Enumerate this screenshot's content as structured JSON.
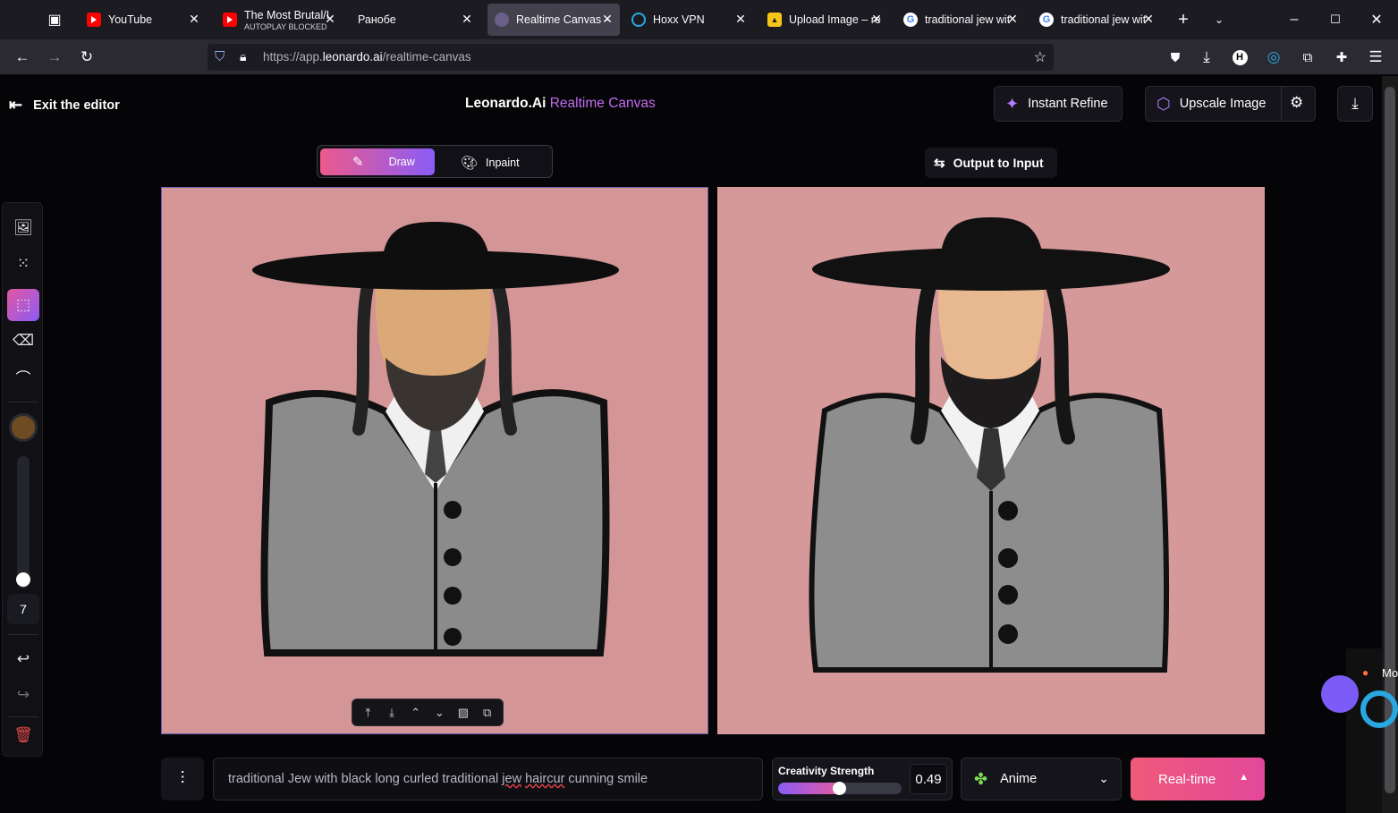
{
  "browser": {
    "tabs": [
      {
        "title": "YouTube",
        "subtitle": "",
        "icon": "youtube-icon"
      },
      {
        "title": "The Most Brutal/I",
        "subtitle": "AUTOPLAY BLOCKED",
        "icon": "youtube-icon"
      },
      {
        "title": "Ранобе",
        "subtitle": "",
        "icon": ""
      },
      {
        "title": "Realtime Canvas -",
        "subtitle": "",
        "icon": "leonardo-icon",
        "active": true
      },
      {
        "title": "Hoxx VPN",
        "subtitle": "",
        "icon": "hoxx-icon"
      },
      {
        "title": "Upload Image – re",
        "subtitle": "",
        "icon": "upload-icon"
      },
      {
        "title": "traditional jew wit",
        "subtitle": "",
        "icon": "google-icon"
      },
      {
        "title": "traditional jew wit",
        "subtitle": "",
        "icon": "google-icon"
      }
    ],
    "url_prefix": "https://app.",
    "url_domain": "leonardo.ai",
    "url_path": "/realtime-canvas"
  },
  "header": {
    "exit_label": "Exit the editor",
    "brand": "Leonardo.Ai",
    "product": "Realtime Canvas",
    "instant_refine": "Instant Refine",
    "upscale_image": "Upscale Image"
  },
  "mode": {
    "draw": "Draw",
    "inpaint": "Inpaint",
    "selected": "Draw"
  },
  "output_to_input": "Output to Input",
  "toolbar": {
    "brush_size": "7",
    "brush_color": "#6e4b20"
  },
  "bottom": {
    "prompt_before": "traditional Jew with black long curled traditional ",
    "prompt_misspelled_1": "jew",
    "prompt_space": " ",
    "prompt_misspelled_2": "haircur",
    "prompt_after": " cunning smile",
    "strength_label": "Creativity Strength",
    "strength_value": "0.49",
    "strength_fraction": 0.49,
    "style": "Anime",
    "realtime": "Real-time"
  },
  "side_popup": {
    "text": "Mo"
  },
  "colors": {
    "accent_purple": "#c36cf2",
    "accent_pink": "#ef5a7a",
    "canvas_bg": "#d39595"
  }
}
